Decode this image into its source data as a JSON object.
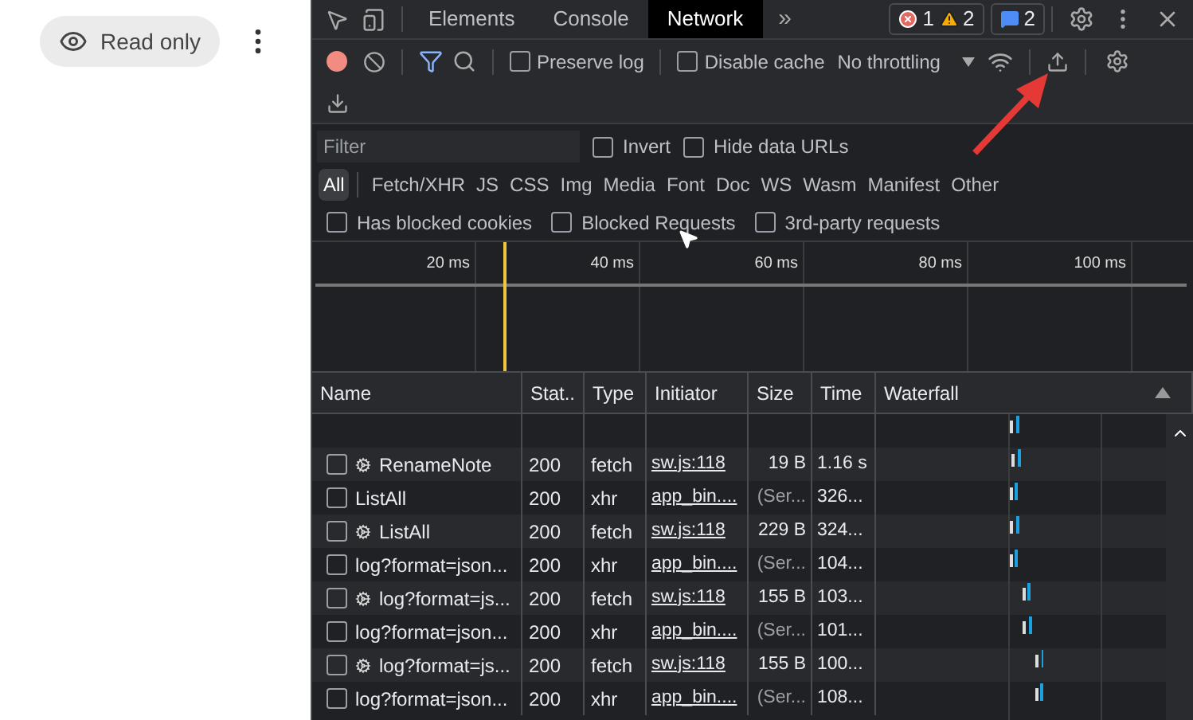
{
  "page": {
    "read_only_label": "Read only"
  },
  "devtools": {
    "tabs": [
      {
        "label": "Elements",
        "selected": false
      },
      {
        "label": "Console",
        "selected": false
      },
      {
        "label": "Network",
        "selected": true
      }
    ],
    "more_tabs": "»",
    "badges": [
      {
        "kind": "error",
        "count": "1"
      },
      {
        "kind": "warning",
        "count": "2"
      }
    ],
    "messages_badge": "2",
    "toolbar": {
      "recording": true,
      "preserve_log": {
        "label": "Preserve log",
        "checked": false
      },
      "disable_cache": {
        "label": "Disable cache",
        "checked": false
      },
      "throttling": "No throttling"
    },
    "filter": {
      "placeholder": "Filter",
      "invert": {
        "label": "Invert",
        "checked": false
      },
      "hide_data_urls": {
        "label": "Hide data URLs",
        "checked": false
      }
    },
    "types": [
      {
        "label": "All",
        "selected": true
      },
      {
        "label": "Fetch/XHR",
        "selected": false
      },
      {
        "label": "JS",
        "selected": false
      },
      {
        "label": "CSS",
        "selected": false
      },
      {
        "label": "Img",
        "selected": false
      },
      {
        "label": "Media",
        "selected": false
      },
      {
        "label": "Font",
        "selected": false
      },
      {
        "label": "Doc",
        "selected": false
      },
      {
        "label": "WS",
        "selected": false
      },
      {
        "label": "Wasm",
        "selected": false
      },
      {
        "label": "Manifest",
        "selected": false
      },
      {
        "label": "Other",
        "selected": false
      }
    ],
    "extra_filters": [
      {
        "label": "Has blocked cookies",
        "checked": false
      },
      {
        "label": "Blocked Requests",
        "checked": false
      },
      {
        "label": "3rd-party requests",
        "checked": false
      }
    ],
    "timeline_ticks": [
      "20 ms",
      "40 ms",
      "60 ms",
      "80 ms",
      "100 ms"
    ],
    "table": {
      "columns": [
        "Name",
        "Stat..",
        "Type",
        "Initiator",
        "Size",
        "Time",
        "Waterfall"
      ],
      "rows": [
        {
          "checked": false,
          "service_worker": true,
          "name": "RenameNote",
          "status": "200",
          "type": "fetch",
          "initiator": "sw.js:118",
          "size": "19 B",
          "size_muted": false,
          "time": "1.16 s"
        },
        {
          "checked": false,
          "service_worker": false,
          "name": "ListAll",
          "status": "200",
          "type": "xhr",
          "initiator": "app_bin....",
          "size": "(Ser...",
          "size_muted": true,
          "time": "326..."
        },
        {
          "checked": false,
          "service_worker": true,
          "name": "ListAll",
          "status": "200",
          "type": "fetch",
          "initiator": "sw.js:118",
          "size": "229 B",
          "size_muted": false,
          "time": "324..."
        },
        {
          "checked": false,
          "service_worker": false,
          "name": "log?format=json...",
          "status": "200",
          "type": "xhr",
          "initiator": "app_bin....",
          "size": "(Ser...",
          "size_muted": true,
          "time": "104..."
        },
        {
          "checked": false,
          "service_worker": true,
          "name": "log?format=js...",
          "status": "200",
          "type": "fetch",
          "initiator": "sw.js:118",
          "size": "155 B",
          "size_muted": false,
          "time": "103..."
        },
        {
          "checked": false,
          "service_worker": false,
          "name": "log?format=json...",
          "status": "200",
          "type": "xhr",
          "initiator": "app_bin....",
          "size": "(Ser...",
          "size_muted": true,
          "time": "101..."
        },
        {
          "checked": false,
          "service_worker": true,
          "name": "log?format=js...",
          "status": "200",
          "type": "fetch",
          "initiator": "sw.js:118",
          "size": "155 B",
          "size_muted": false,
          "time": "100..."
        },
        {
          "checked": false,
          "service_worker": false,
          "name": "log?format=json...",
          "status": "200",
          "type": "xhr",
          "initiator": "app_bin....",
          "size": "(Ser...",
          "size_muted": true,
          "time": "108..."
        }
      ]
    }
  }
}
